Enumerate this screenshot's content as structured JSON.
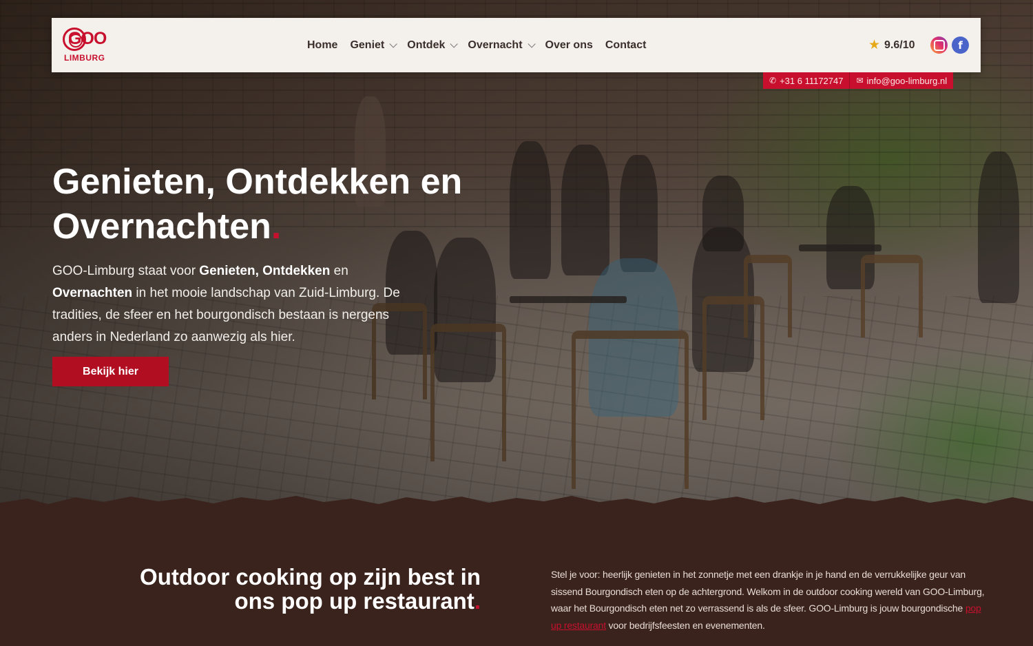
{
  "brand": {
    "logo_main": "GOO",
    "logo_sub": "LIMBURG",
    "accent": "#c8102e",
    "bg_dark": "#3a231c"
  },
  "nav": {
    "items": [
      {
        "label": "Home",
        "dropdown": false
      },
      {
        "label": "Geniet",
        "dropdown": true
      },
      {
        "label": "Ontdek",
        "dropdown": true
      },
      {
        "label": "Overnacht",
        "dropdown": true
      },
      {
        "label": "Over ons",
        "dropdown": false
      },
      {
        "label": "Contact",
        "dropdown": false
      }
    ]
  },
  "rating": {
    "icon": "star-icon",
    "value": "9.6/10"
  },
  "social": {
    "instagram_icon": "instagram-icon",
    "facebook_icon": "facebook-icon",
    "facebook_glyph": "f"
  },
  "contact": {
    "phone": "+31 6 11172747",
    "email": "info@goo-limburg.nl"
  },
  "hero": {
    "title_line1": "Genieten, Ontdekken en",
    "title_line2": "Overnachten",
    "title_dot": ".",
    "text_intro": "GOO-Limburg staat voor ",
    "text_bold1": "Genieten, Ontdekken",
    "text_en": " en ",
    "text_bold2": "Overnachten",
    "text_rest": " in het mooie landschap van Zuid-Limburg. De tradities, de sfeer en het bourgondisch bestaan is nergens anders in Nederland zo aanwezig als hier.",
    "cta_label": "Bekijk hier"
  },
  "section": {
    "title_line1": "Outdoor cooking op zijn best in",
    "title_line2": "ons pop up restaurant",
    "title_dot": ".",
    "text_before_link": "Stel je voor: heerlijk genieten in het zonnetje met een drankje in je hand en de verrukkelijke geur van sissend Bourgondisch eten op de achtergrond. Welkom in de outdoor cooking wereld van GOO-Limburg, waar het Bourgondisch eten net zo verrassend is als de sfeer. GOO-Limburg is jouw bourgondische ",
    "link_text": "pop up restaurant",
    "text_after_link": " voor bedrijfsfeesten en evenementen."
  }
}
